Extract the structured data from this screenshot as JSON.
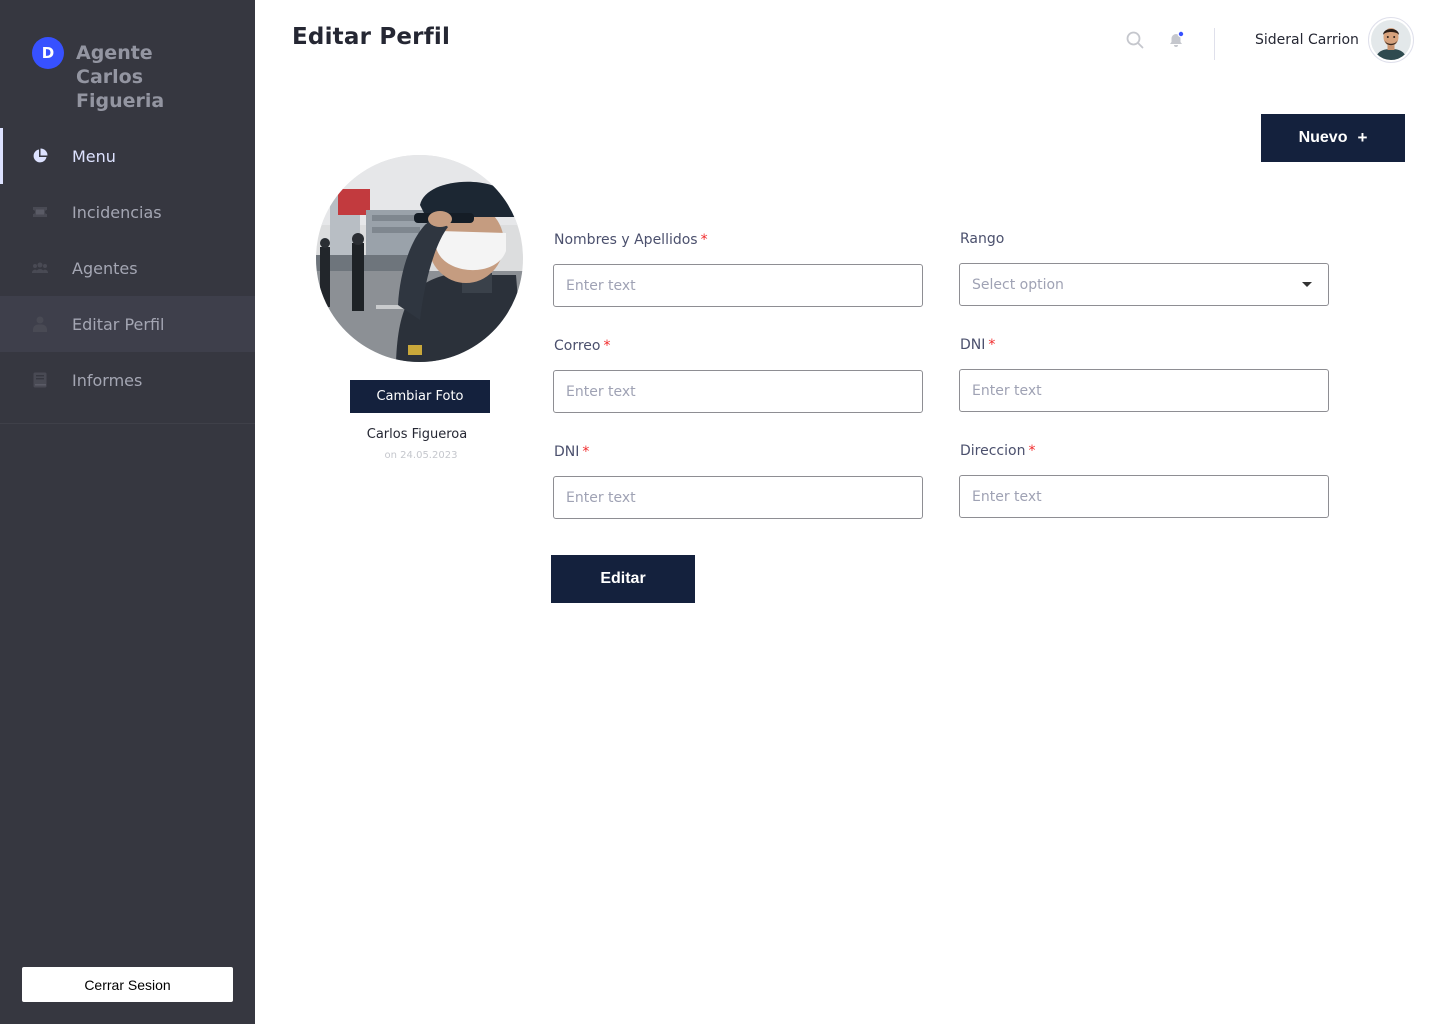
{
  "sidebar": {
    "brand_initial": "D",
    "brand_name": "Agente Carlos Figueria",
    "items": [
      {
        "label": "Menu",
        "icon": "pie-chart-icon"
      },
      {
        "label": "Incidencias",
        "icon": "ticket-icon"
      },
      {
        "label": "Agentes",
        "icon": "users-icon"
      },
      {
        "label": "Editar Perfil",
        "icon": "user-icon"
      },
      {
        "label": "Informes",
        "icon": "book-icon"
      }
    ],
    "logout_label": "Cerrar Sesion"
  },
  "header": {
    "title": "Editar Perfil",
    "user_name": "Sideral Carrion",
    "icons": [
      "search-icon",
      "bell-icon"
    ]
  },
  "actions": {
    "new_label": "Nuevo",
    "new_plus": "+",
    "edit_label": "Editar"
  },
  "profile": {
    "change_photo_label": "Cambiar Foto",
    "name": "Carlos Figueroa",
    "date": "on 24.05.2023"
  },
  "form": {
    "required_mark": "*",
    "fields": [
      {
        "label": "Nombres y Apellidos",
        "placeholder": "Enter text",
        "required": true
      },
      {
        "label": "Rango",
        "placeholder": "Select option",
        "required": false,
        "type": "select"
      },
      {
        "label": "Correo",
        "placeholder": "Enter text",
        "required": true
      },
      {
        "label": "DNI",
        "placeholder": "Enter text",
        "required": true
      },
      {
        "label": "DNI",
        "placeholder": "Enter text",
        "required": true
      },
      {
        "label": "Direccion",
        "placeholder": "Enter text",
        "required": true
      }
    ]
  },
  "colors": {
    "sidebar_bg": "#363740",
    "accent": "#3751FF",
    "primary_button": "#14213D",
    "required": "#F12B2C"
  }
}
